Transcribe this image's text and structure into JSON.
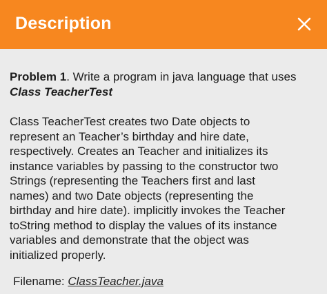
{
  "header": {
    "title": "Description",
    "background_color": "#f7871f",
    "text_color": "#ffffff",
    "close_icon": "close-icon"
  },
  "content": {
    "problem_label": "Problem 1",
    "problem_text": ". Write a program in java language that uses",
    "class_name": "Class TeacherTest",
    "description": "Class TeacherTest creates two Date objects to\nrepresent an Teacher’s birthday and hire date,\nrespectively.  Creates an Teacher and initializes its\ninstance variables by passing to the constructor two\nStrings (representing the Teachers first and last\nnames) and two Date objects (representing the\nbirthday and hire date). implicitly invokes the Teacher\ntoString method to display the values of its instance\nvariables and demonstrate that the object was\ninitialized properly.",
    "filename_label": "Filename: ",
    "filename_value": "ClassTeacher.java"
  }
}
